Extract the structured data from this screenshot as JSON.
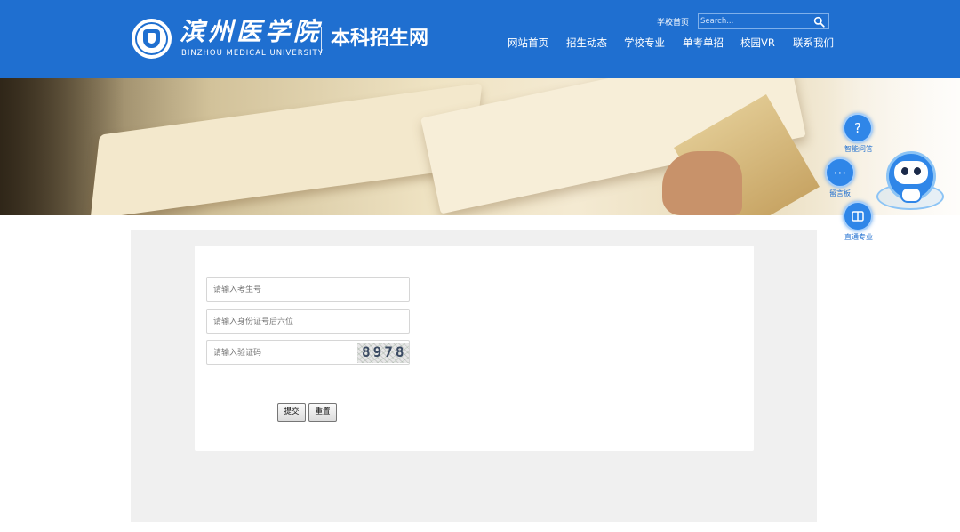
{
  "header": {
    "logo_cn": "滨州医学院",
    "logo_en": "BINZHOU MEDICAL UNIVERSITY",
    "site_title": "本科招生网",
    "top_link": "学校首页",
    "search_placeholder": "Search...",
    "nav": [
      "网站首页",
      "招生动态",
      "学校专业",
      "单考单招",
      "校园VR",
      "联系我们"
    ]
  },
  "floating": {
    "items": [
      {
        "label": "智能问答",
        "icon": "question-icon"
      },
      {
        "label": "留言板",
        "icon": "chat-bubble-icon"
      },
      {
        "label": "直通专业",
        "icon": "book-icon"
      }
    ],
    "robot_icon": "robot-assistant-icon"
  },
  "form": {
    "exam_number_placeholder": "请输入考生号",
    "id_last_six_placeholder": "请输入身份证号后六位",
    "captcha_placeholder": "请输入验证码",
    "captcha_code": "8978",
    "submit_label": "提交",
    "reset_label": "重置"
  },
  "colors": {
    "header_blue": "#1f6fd0",
    "content_gray": "#f0f0f0",
    "widget_blue": "#2f86e8"
  }
}
